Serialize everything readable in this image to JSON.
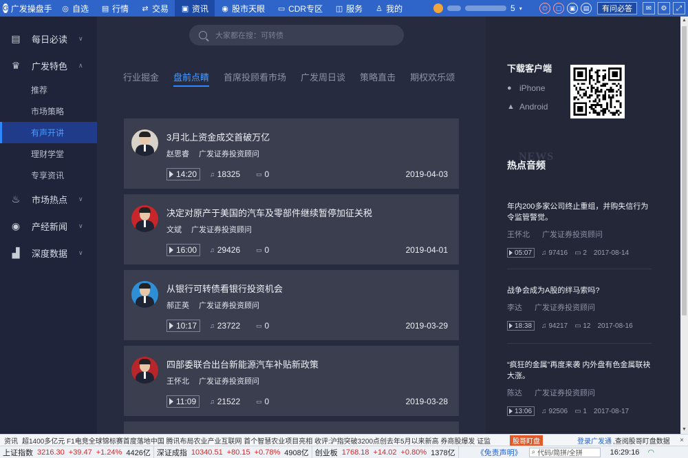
{
  "app": {
    "name": "广发操盘手",
    "logo_letter": "G"
  },
  "nav": [
    {
      "label": "自选",
      "icon": "◎",
      "icon_name": "watchlist-icon"
    },
    {
      "label": "行情",
      "icon": "▤",
      "icon_name": "chart-icon"
    },
    {
      "label": "交易",
      "icon": "⇄",
      "icon_name": "trade-icon"
    },
    {
      "label": "资讯",
      "icon": "▣",
      "icon_name": "news-icon"
    },
    {
      "label": "股市天眼",
      "icon": "◉",
      "icon_name": "eye-icon"
    },
    {
      "label": "CDR专区",
      "icon": "▭",
      "icon_name": "cdr-icon"
    },
    {
      "label": "服务",
      "icon": "◫",
      "icon_name": "service-icon"
    },
    {
      "label": "我的",
      "icon": "♙",
      "icon_name": "user-icon"
    }
  ],
  "top_right": {
    "ask_button": "有问必答",
    "user_suffix": "5"
  },
  "sidebar": {
    "daily": "每日必读",
    "featured": "广发特色",
    "featured_items": [
      "推荐",
      "市场策略",
      "有声开讲",
      "理财学堂",
      "专享资讯"
    ],
    "hot": "市场热点",
    "industry": "产经新闻",
    "depth": "深度数据"
  },
  "search": {
    "placeholder": "大家都在搜：可转债"
  },
  "tabs": [
    "行业掘金",
    "盘前点睛",
    "首席投顾看市场",
    "广发周日谈",
    "策略直击",
    "期权欢乐颂"
  ],
  "active_tab": 1,
  "cards": [
    {
      "title": "3月北上资金成交首破万亿",
      "author": "赵思睿",
      "org": "广发证券投资顾问",
      "duration": "14:20",
      "plays": "18325",
      "comments": "0",
      "date": "2019-04-03",
      "avatar_bg": "#d8d2c8"
    },
    {
      "title": "决定对原产于美国的汽车及零部件继续暂停加征关税",
      "author": "文斌",
      "org": "广发证券投资顾问",
      "duration": "16:00",
      "plays": "29426",
      "comments": "0",
      "date": "2019-04-01",
      "avatar_bg": "#c8262b"
    },
    {
      "title": "从银行可转债看银行投资机会",
      "author": "郝正英",
      "org": "广发证券投资顾问",
      "duration": "10:17",
      "plays": "23722",
      "comments": "0",
      "date": "2019-03-29",
      "avatar_bg": "#2f8fd6"
    },
    {
      "title": "四部委联合出台新能源汽车补贴新政策",
      "author": "王怀北",
      "org": "广发证券投资顾问",
      "duration": "11:09",
      "plays": "21522",
      "comments": "0",
      "date": "2019-03-28",
      "avatar_bg": "#b8262b"
    }
  ],
  "right": {
    "download_title": "下载客户端",
    "iphone": "iPhone",
    "android": "Android",
    "news_watermark": "NEWS",
    "hot_title": "热点音频",
    "hot_items": [
      {
        "title": "年内200多家公司终止重组，并购失信行为令监管警觉。",
        "author": "王怀北",
        "org": "广发证券投资顾问",
        "duration": "05:07",
        "plays": "97416",
        "comments": "2",
        "date": "2017-08-14"
      },
      {
        "title": "战争会成为A股的绊马索吗?",
        "author": "李达",
        "org": "广发证券投资顾问",
        "duration": "18:38",
        "plays": "94217",
        "comments": "12",
        "date": "2017-08-16"
      },
      {
        "title": "“疯狂的金属”再度来袭 内外盘有色金属联袂大涨。",
        "author": "陈达",
        "org": "广发证券投资顾问",
        "duration": "13:06",
        "plays": "92506",
        "comments": "1",
        "date": "2017-08-17"
      }
    ]
  },
  "ticker": {
    "label": "资讯",
    "text": "超1400多亿元   F1电竞全球锦标赛首度落地中国   腾讯布局农业产业互联网 首个智慧农业项目亮相   收评:沪指突破3200点创去年5月以来新高 券商股爆发   证监",
    "tag": "股哥盯盘",
    "link1": "登录广发通",
    "link2": ",查阅股哥盯盘数据",
    "close": "×"
  },
  "status": {
    "indices": [
      {
        "name": "上证指数",
        "value": "3216.30",
        "change": "+39.47",
        "pct": "+1.24%",
        "amount": "4426亿"
      },
      {
        "name": "深证成指",
        "value": "10340.51",
        "change": "+80.15",
        "pct": "+0.78%",
        "amount": "4908亿"
      },
      {
        "name": "创业板",
        "value": "1768.18",
        "change": "+14.02",
        "pct": "+0.80%",
        "amount": "1378亿"
      }
    ],
    "disclaimer": "《免责声明》",
    "search_placeholder": "代码/简拼/全拼",
    "time": "16:29:16"
  }
}
